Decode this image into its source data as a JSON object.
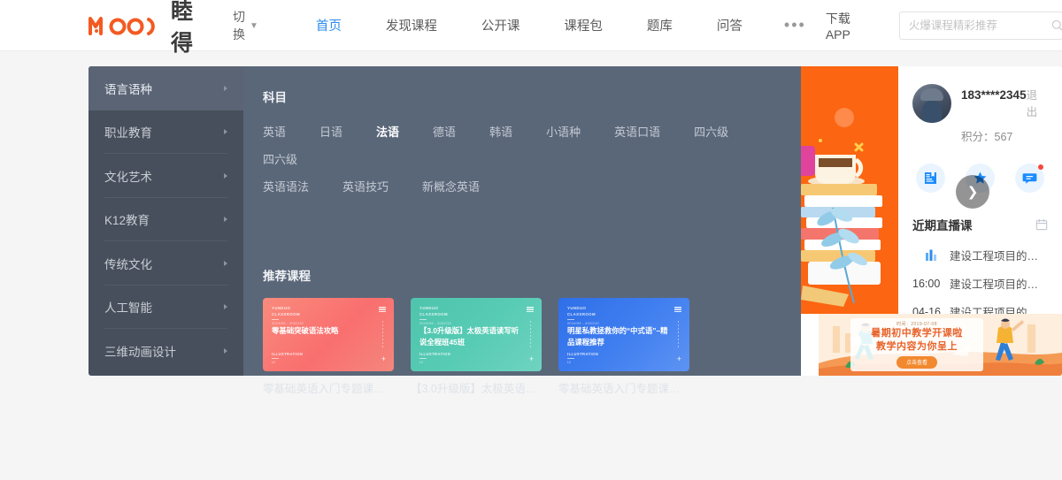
{
  "header": {
    "logo_text": "睦得",
    "logo_mark": "MOOD",
    "switch_label": "切换",
    "switch_icon": "chevron-down-icon",
    "nav_links": [
      {
        "label": "首页",
        "active": true
      },
      {
        "label": "发现课程",
        "active": false
      },
      {
        "label": "公开课",
        "active": false
      },
      {
        "label": "课程包",
        "active": false
      },
      {
        "label": "题库",
        "active": false
      },
      {
        "label": "问答",
        "active": false
      }
    ],
    "more_label": "•••",
    "download_app": "下载APP",
    "search": {
      "placeholder": "火爆课程精彩推荐",
      "value": "",
      "icon": "search-icon"
    }
  },
  "mega_menu": {
    "categories": [
      {
        "label": "语言语种",
        "active": true
      },
      {
        "label": "职业教育",
        "active": false
      },
      {
        "label": "文化艺术",
        "active": false
      },
      {
        "label": "K12教育",
        "active": false
      },
      {
        "label": "传统文化",
        "active": false
      },
      {
        "label": "人工智能",
        "active": false
      },
      {
        "label": "三维动画设计",
        "active": false
      }
    ],
    "subject_heading": "科目",
    "subject_rows": [
      [
        {
          "label": "英语",
          "selected": false
        },
        {
          "label": "日语",
          "selected": false
        },
        {
          "label": "法语",
          "selected": true
        },
        {
          "label": "德语",
          "selected": false
        },
        {
          "label": "韩语",
          "selected": false
        },
        {
          "label": "小语种",
          "selected": false
        },
        {
          "label": "英语口语",
          "selected": false
        },
        {
          "label": "四六级",
          "selected": false
        },
        {
          "label": "四六级",
          "selected": false
        }
      ],
      [
        {
          "label": "英语语法",
          "selected": false
        },
        {
          "label": "英语技巧",
          "selected": false
        },
        {
          "label": "新概念英语",
          "selected": false
        }
      ]
    ],
    "recommend_heading": "推荐课程",
    "cards": [
      {
        "brand_line1": "YUNDUO",
        "brand_line2": "CLASSROOM",
        "date": "2019/09 - 2020/10",
        "title": "零基础突破语法攻略",
        "foot1": "ILLUSTRATION",
        "foot2": "UI",
        "caption": "零基础英语入门专题课从语法...",
        "color": "#f96f6f"
      },
      {
        "brand_line1": "YUNDUO",
        "brand_line2": "CLASSROOM",
        "date": "2019/09 - 2020/10",
        "title": "【3.0升级版】太极英语读写听说全程班45班",
        "foot1": "ILLUSTRATION",
        "foot2": "UI",
        "caption": "【3.0升级版】太极英语读写...",
        "color": "#57cbb4"
      },
      {
        "brand_line1": "YUNDUO",
        "brand_line2": "CLASSROOM",
        "date": "2019/09 - 2020/10",
        "title": "明星私教拯救你的“中式语”–精品课程推荐",
        "foot1": "ILLUSTRATION",
        "foot2": "UI",
        "caption": "零基础英语入门专题课从语法...",
        "color": "#3f7ef0"
      }
    ],
    "hero": {
      "background_color": "#fc6511",
      "next_icon": "chevron-right-icon"
    }
  },
  "user_panel": {
    "avatar_icon": "avatar",
    "phone": "183****2345",
    "logout_label": "退出",
    "points_label": "积分：567",
    "quick_buttons": [
      {
        "icon": "notebook-icon",
        "badge": false
      },
      {
        "icon": "star-icon",
        "badge": false
      },
      {
        "icon": "message-icon",
        "badge": true
      }
    ]
  },
  "live_section": {
    "title": "近期直播课",
    "calendar_icon": "calendar-icon",
    "rows": [
      {
        "time": "",
        "icon": "live-bars-icon",
        "name": "建设工程项目的组织与..."
      },
      {
        "time": "16:00",
        "icon": "",
        "name": "建设工程项目的组织与..."
      },
      {
        "time": "04-16",
        "icon": "",
        "name": "建设工程项目的组织与..."
      }
    ]
  },
  "promo_banner": {
    "date_text": "时间：2019-07-08",
    "line1": "暑期初中教学开课啦",
    "line2": "教学内容为你呈上",
    "button_label": "点击查看"
  },
  "colors": {
    "accent_blue": "#2b8ced",
    "brand_orange": "#f35a22",
    "panel_bg": "#5a6779",
    "sidebar_bg": "#474f5c",
    "sidebar_active": "#5a6475",
    "hero_orange": "#fc6511"
  }
}
